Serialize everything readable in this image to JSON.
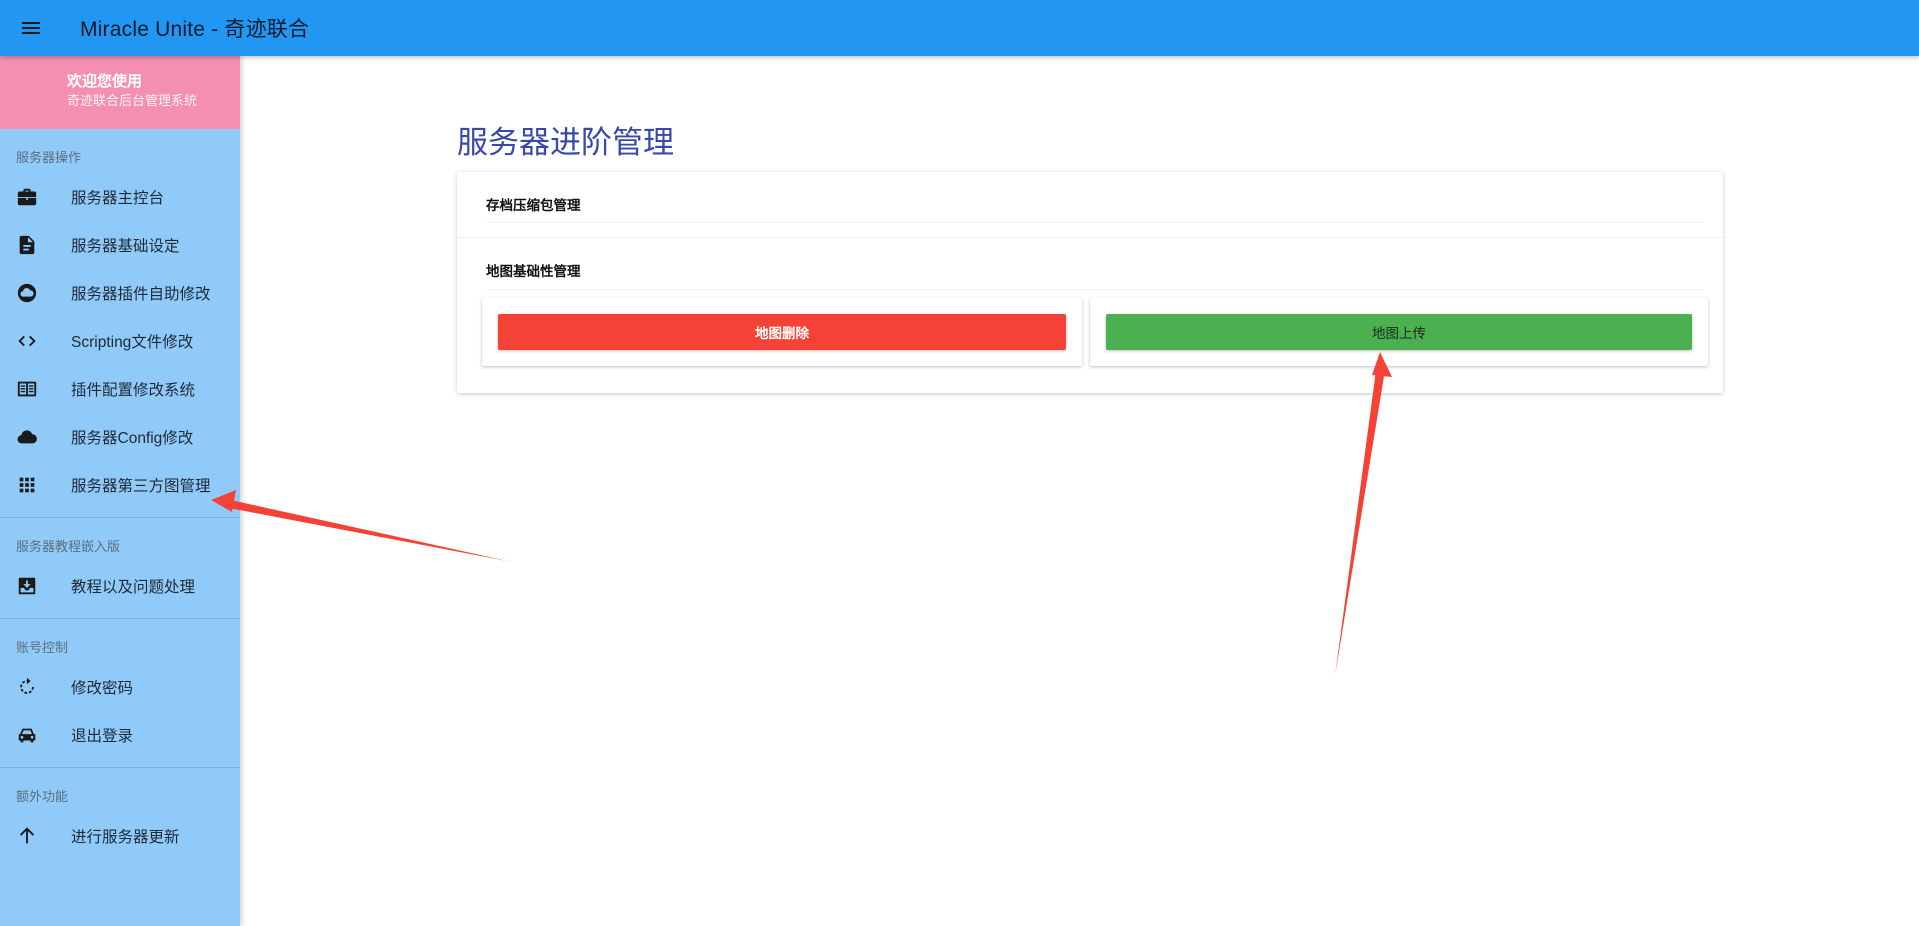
{
  "header": {
    "title": "Miracle Unite - 奇迹联合",
    "menu_icon": "menu-icon",
    "color": "#2196f3"
  },
  "sidebar": {
    "welcome": {
      "title": "欢迎您使用",
      "subtitle": "奇迹联合后台管理系统",
      "color": "#f48fb1"
    },
    "color": "#90caf9",
    "groups": [
      {
        "header": "服务器操作",
        "items": [
          {
            "label": "服务器主控台",
            "icon": "briefcase-icon"
          },
          {
            "label": "服务器基础设定",
            "icon": "document-icon"
          },
          {
            "label": "服务器插件自助修改",
            "icon": "cloud-circle-icon"
          },
          {
            "label": "Scripting文件修改",
            "icon": "code-icon"
          },
          {
            "label": "插件配置修改系统",
            "icon": "chrome-reader-icon"
          },
          {
            "label": "服务器Config修改",
            "icon": "cloud-icon"
          },
          {
            "label": "服务器第三方图管理",
            "icon": "apps-grid-icon"
          }
        ]
      },
      {
        "header": "服务器教程嵌入版",
        "items": [
          {
            "label": "教程以及问题处理",
            "icon": "archive-icon"
          }
        ]
      },
      {
        "header": "账号控制",
        "items": [
          {
            "label": "修改密码",
            "icon": "refresh-icon"
          },
          {
            "label": "退出登录",
            "icon": "car-icon"
          }
        ]
      },
      {
        "header": "额外功能",
        "items": [
          {
            "label": "进行服务器更新",
            "icon": "arrow-up-icon"
          }
        ]
      }
    ]
  },
  "main": {
    "title": "服务器进阶管理",
    "title_color": "#3949ab",
    "sections": [
      {
        "header": "存档压缩包管理"
      },
      {
        "header": "地图基础性管理"
      }
    ],
    "buttons": {
      "delete_label": "地图删除",
      "delete_color": "#f44336",
      "upload_label": "地图上传",
      "upload_color": "#4caf50"
    }
  },
  "annotations": {
    "arrow_color": "#f44336"
  }
}
